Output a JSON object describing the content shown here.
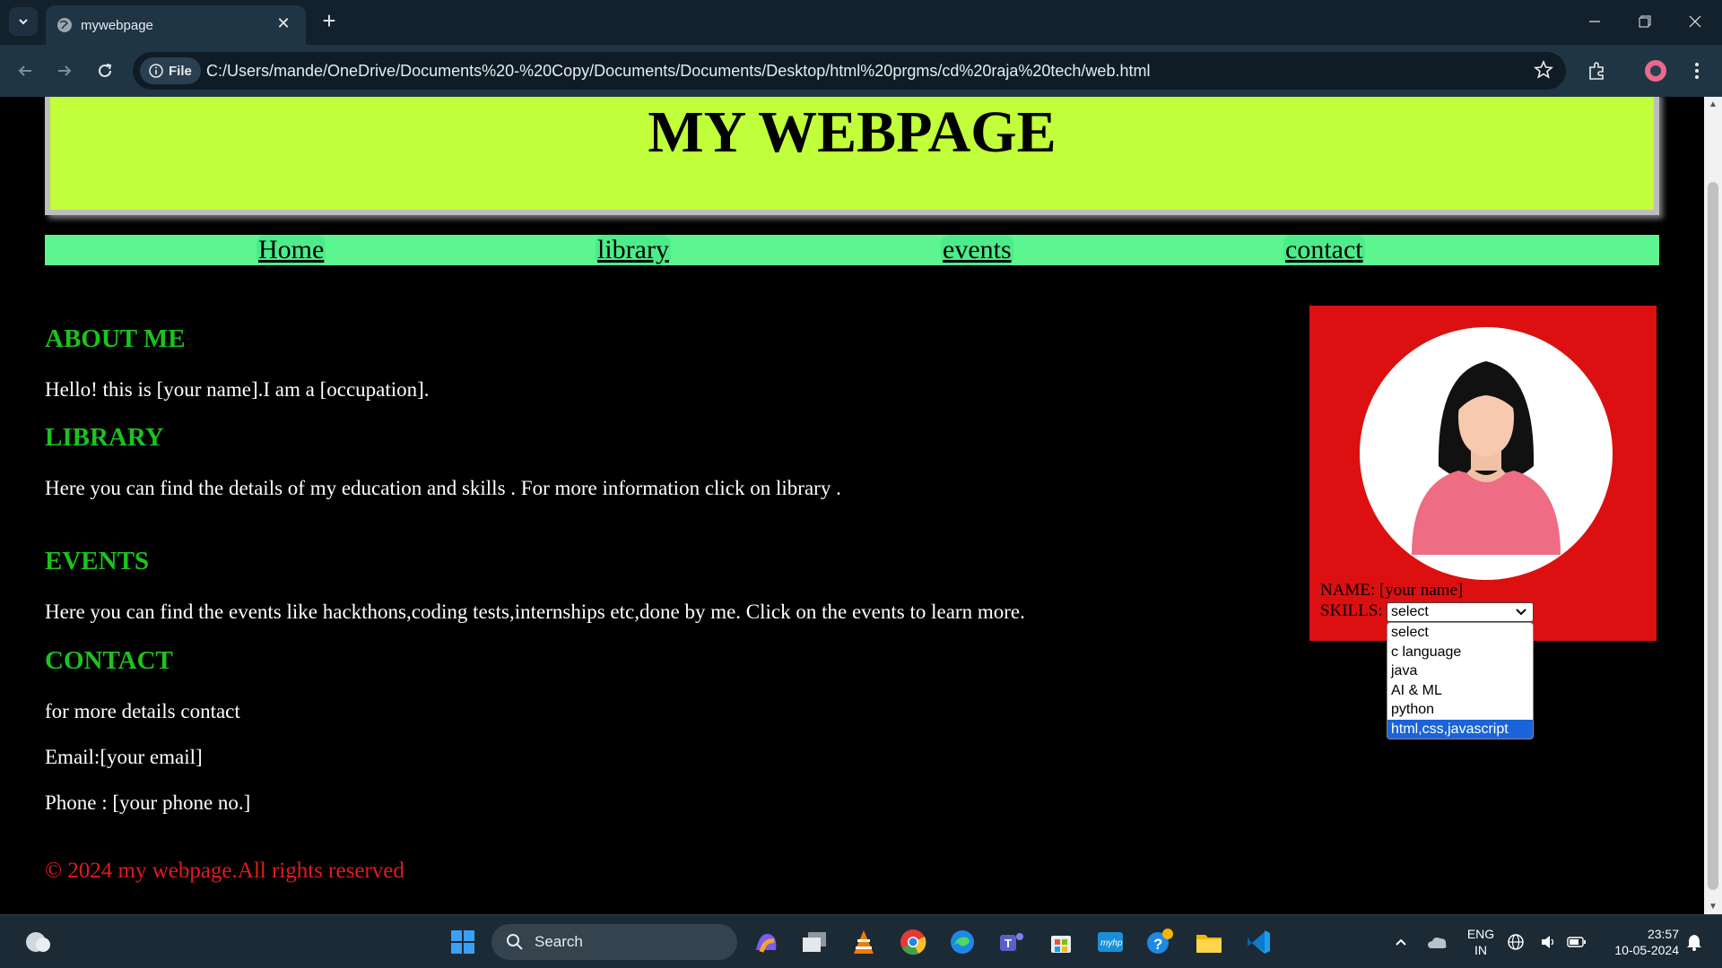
{
  "browser": {
    "tab_title": "mywebpage",
    "new_tab": "+",
    "site_info_label": "File",
    "url": "C:/Users/mande/OneDrive/Documents%20-%20Copy/Documents/Documents/Desktop/html%20prgms/cd%20raja%20tech/web.html"
  },
  "page": {
    "heading": "MY WEBPAGE",
    "menu": [
      "Home",
      "library",
      "events",
      "contact"
    ],
    "about": {
      "heading": "ABOUT ME",
      "text": "Hello! this is [your name].I am a [occupation]."
    },
    "library": {
      "heading": "LIBRARY",
      "text": "Here you can find the details of my education and skills . For more information click on library ."
    },
    "events": {
      "heading": "EVENTS",
      "text": "Here you can find the events like hackthons,coding tests,internships etc,done by me. Click on the events to learn more."
    },
    "contact": {
      "heading": "CONTACT",
      "text": "for more details contact",
      "email": "Email:[your email]",
      "phone": "Phone : [your phone no.]"
    },
    "footer": "© 2024 my webpage.All rights reserved",
    "profile": {
      "name_line": "NAME: [your name]",
      "skills_label": "SKILLS:",
      "skills_selected": "select",
      "skills_options": [
        "select",
        "c language",
        "java",
        "AI & ML",
        "python",
        "html,css,javascript"
      ]
    }
  },
  "taskbar": {
    "search_label": "Search",
    "language": "ENG",
    "region": "IN",
    "time": "23:57",
    "date": "10-05-2024"
  },
  "colors": {
    "header_bg": "#c0ff3a",
    "menu_bg": "#5cf58f",
    "section_heading": "#1dc21d",
    "footer": "#e51a1a",
    "profile_bg": "#dc1010"
  }
}
